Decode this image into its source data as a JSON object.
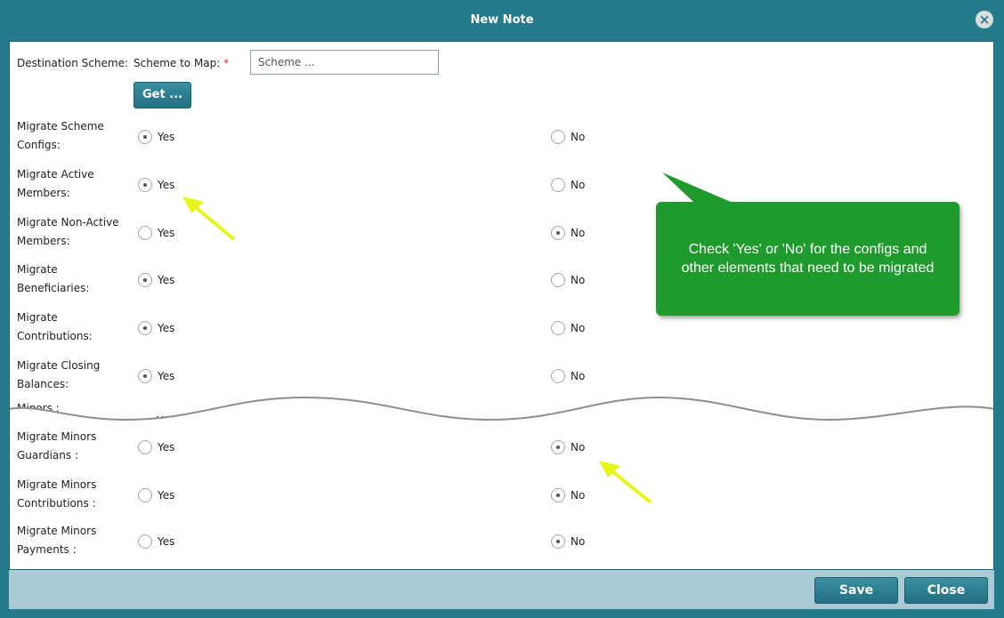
{
  "dialog": {
    "title": "New Note"
  },
  "destination": {
    "label": "Destination Scheme:",
    "scheme_label": "Scheme to Map:",
    "required_mark": "*",
    "scheme_placeholder": "Scheme ...",
    "get_button": "Get ..."
  },
  "options": {
    "yes": "Yes",
    "no": "No"
  },
  "rows_top": [
    {
      "line1": "Migrate Scheme",
      "line2": "Configs:",
      "selected": "yes"
    },
    {
      "line1": "Migrate Active",
      "line2": "Members:",
      "selected": "yes"
    },
    {
      "line1": "Migrate Non-Active",
      "line2": "Members:",
      "selected": "no"
    },
    {
      "line1": "Migrate",
      "line2": "Beneficiaries:",
      "selected": "yes"
    },
    {
      "line1": "Migrate",
      "line2": "Contributions:",
      "selected": "yes"
    },
    {
      "line1": "Migrate Closing",
      "line2": "Balances:",
      "selected": "yes"
    }
  ],
  "cut_row": {
    "label": "Minors :",
    "yes": "Yes"
  },
  "rows_bottom": [
    {
      "line1": "Migrate Minors",
      "line2": "Guardians :",
      "selected": "no"
    },
    {
      "line1": "Migrate Minors",
      "line2": "Contributions :",
      "selected": "no"
    },
    {
      "line1": "Migrate Minors",
      "line2": "Payments :",
      "selected": "no"
    }
  ],
  "callout": {
    "text": "Check 'Yes' or 'No' for the configs and other elements that need to be migrated"
  },
  "footer": {
    "save": "Save",
    "close": "Close"
  },
  "icons": {
    "close": "close-circle-icon",
    "annotation": "arrow-icon"
  },
  "colors": {
    "header": "#257a8c",
    "callout": "#1f9b2d",
    "arrow": "#e8f51a",
    "footer": "#a8cbd6"
  }
}
